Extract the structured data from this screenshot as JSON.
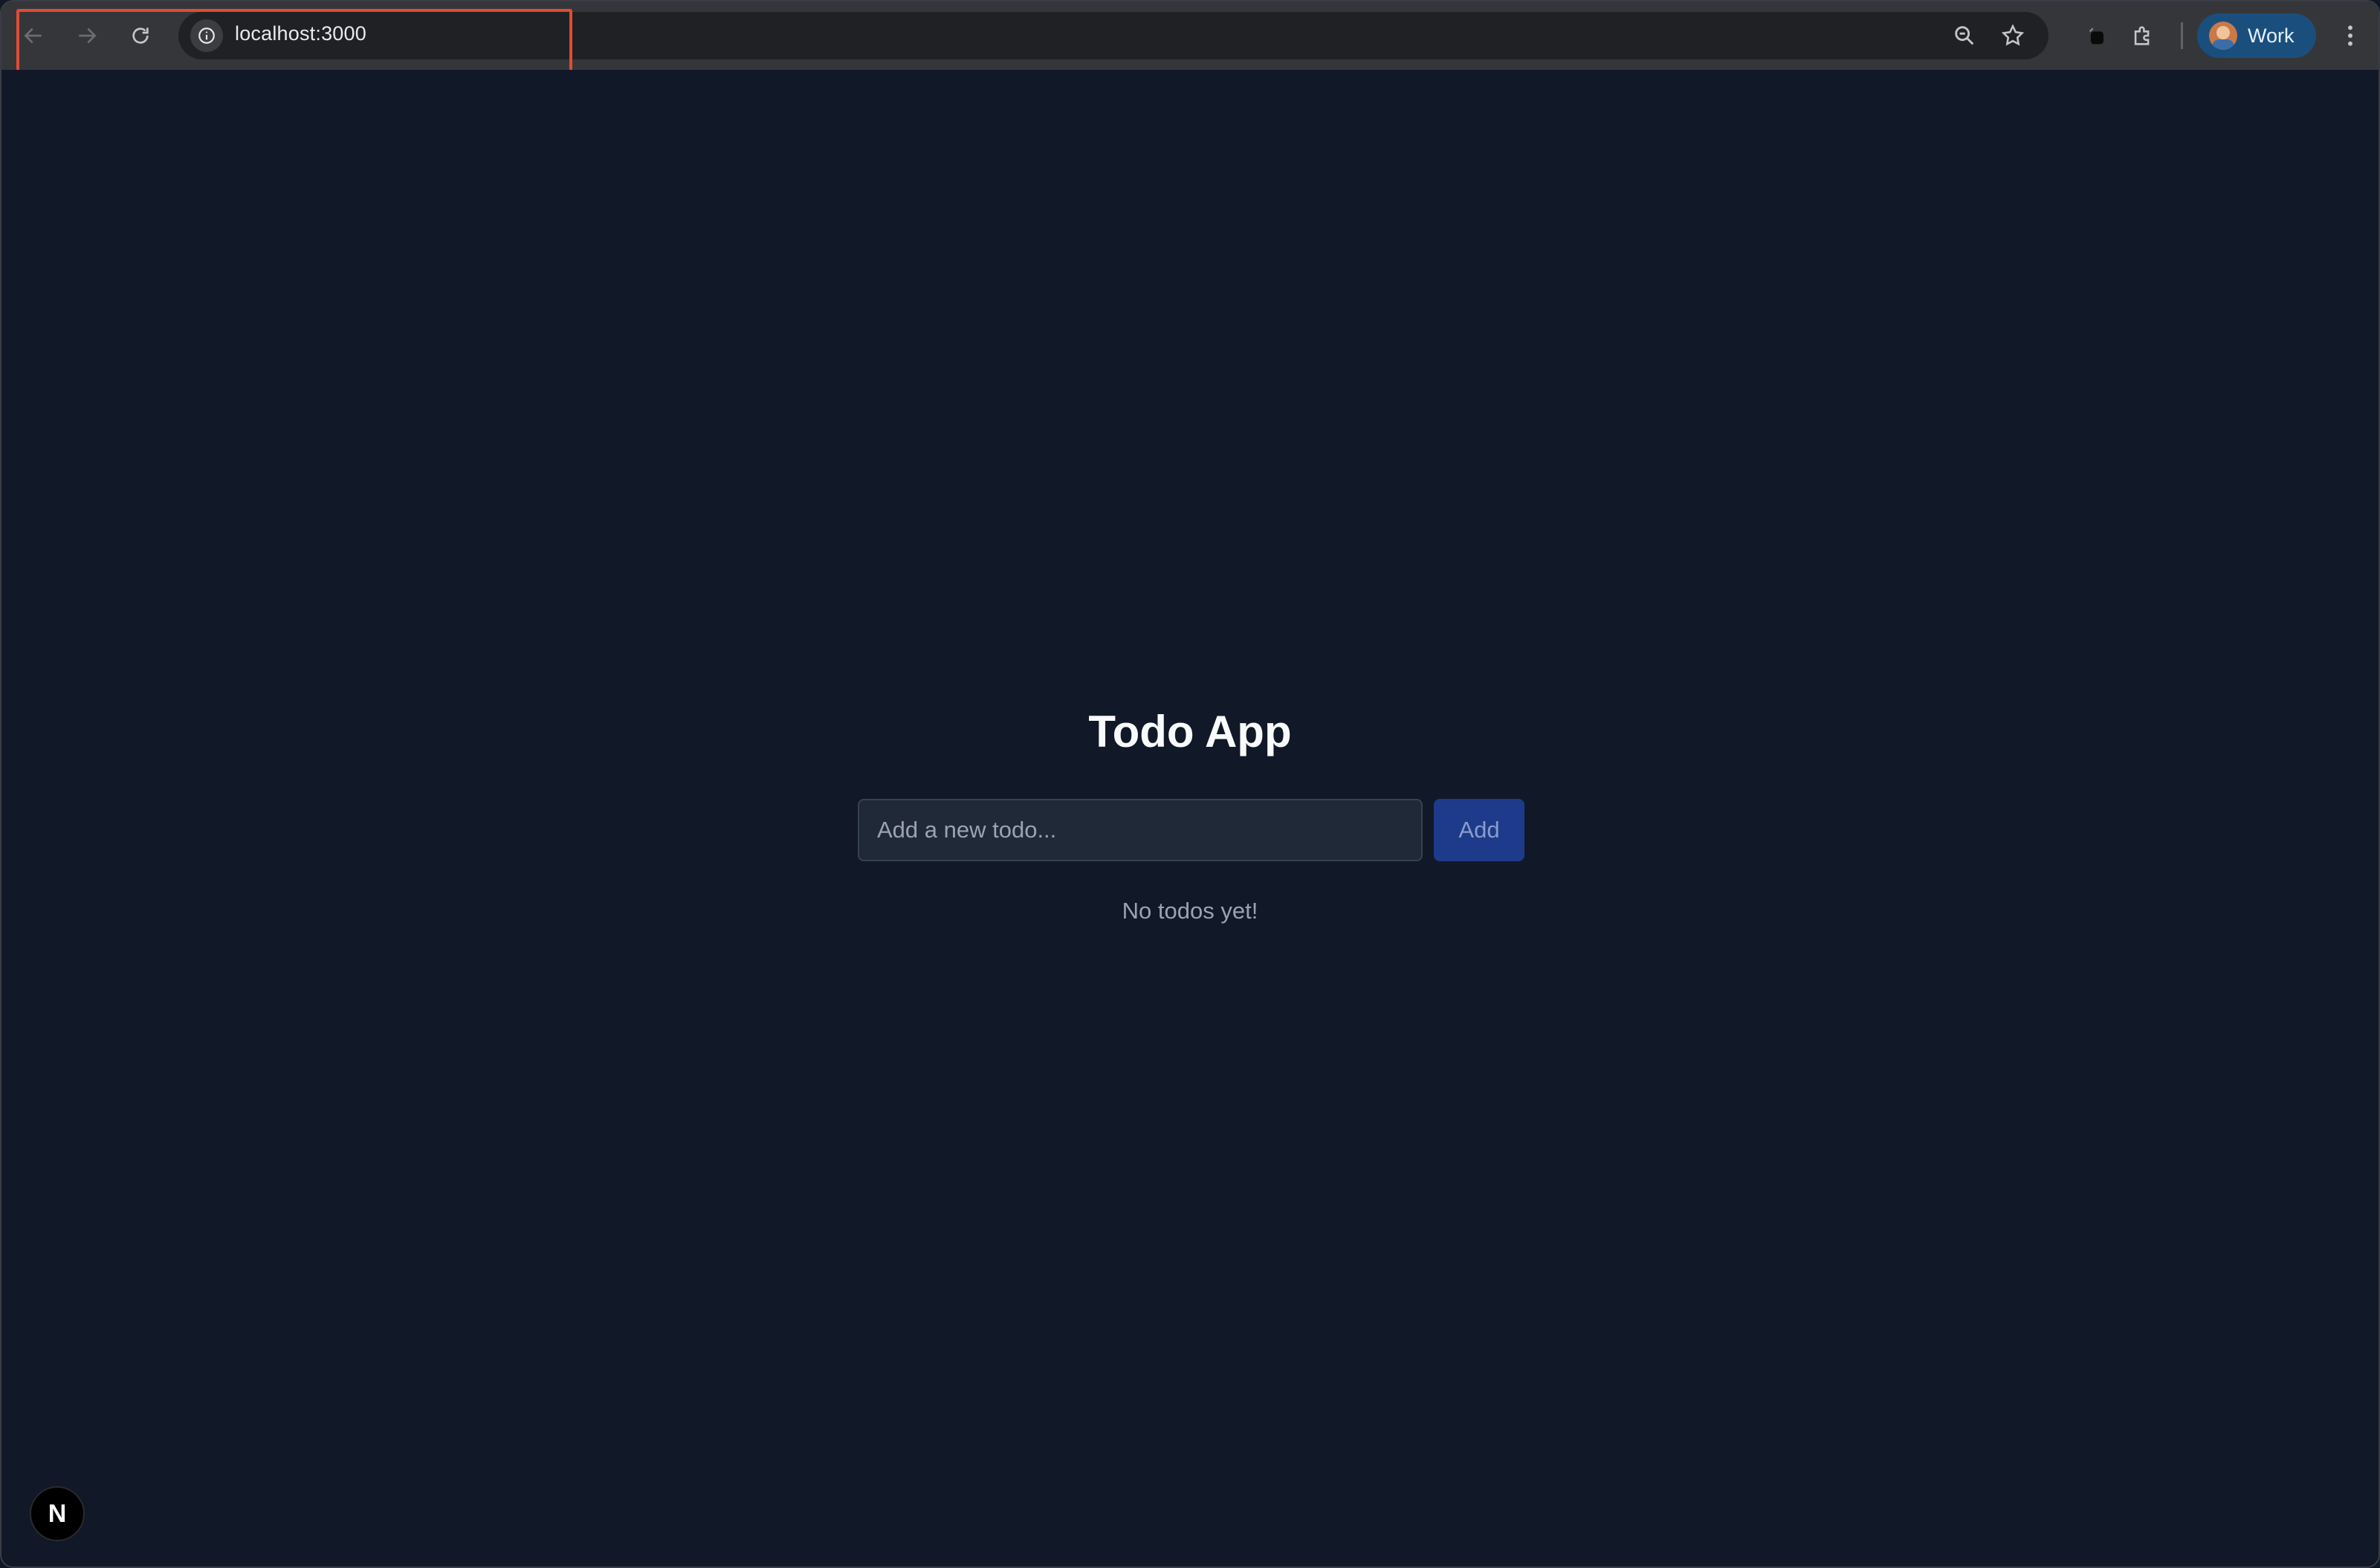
{
  "browser": {
    "url": "localhost:3000",
    "profile_label": "Work",
    "highlight_color": "#e04b33"
  },
  "icons": {
    "back": "arrow-left-icon",
    "forward": "arrow-right-icon",
    "reload": "reload-icon",
    "info": "info-icon",
    "zoom": "zoom-icon",
    "bookmark": "star-icon",
    "extension": "puzzle-icon",
    "menu": "kebab-menu-icon"
  },
  "app": {
    "title": "Todo App",
    "input_placeholder": "Add a new todo...",
    "input_value": "",
    "add_label": "Add",
    "empty_message": "No todos yet!",
    "dev_badge": "N"
  },
  "colors": {
    "page_bg": "#111827",
    "accent_button": "#1e3a8a"
  }
}
